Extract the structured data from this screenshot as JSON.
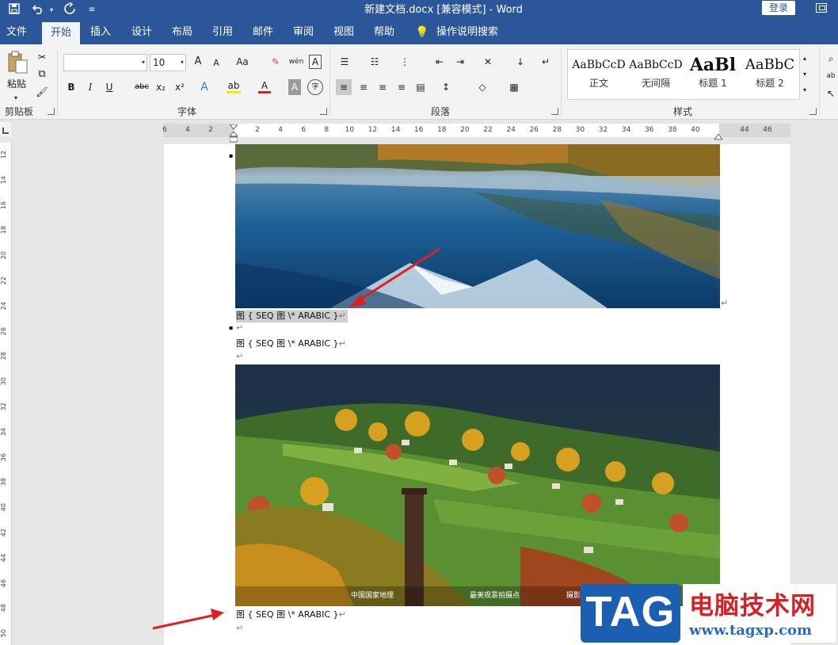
{
  "window": {
    "doc_title": "新建文档.docx [兼容模式]  -  Word",
    "login_label": "登录",
    "quick_access": [
      "save-icon",
      "undo-icon",
      "redo-icon",
      "customize-icon"
    ]
  },
  "tabs": [
    "文件",
    "开始",
    "插入",
    "设计",
    "布局",
    "引用",
    "邮件",
    "审阅",
    "视图",
    "帮助"
  ],
  "active_tab": "开始",
  "tell_me": "操作说明搜索",
  "ribbon": {
    "clipboard": {
      "paste_label": "粘贴",
      "group_label": "剪贴板"
    },
    "font": {
      "font_name": "",
      "font_size": "10",
      "grow_label": "A",
      "shrink_label": "A",
      "change_case_label": "Aa",
      "pinyin_label": "wén",
      "border_char_label": "A",
      "bold": "B",
      "italic": "I",
      "underline": "U",
      "strike": "abc",
      "subscript": "x₂",
      "superscript": "x²",
      "text_effect": "A",
      "highlight": "ab",
      "font_color": "A",
      "char_shading": "A",
      "enclose": "字",
      "group_label": "字体"
    },
    "paragraph": {
      "group_label": "段落"
    },
    "styles": {
      "items": [
        {
          "sample": "AaBbCcD",
          "name": "正文"
        },
        {
          "sample": "AaBbCcD",
          "name": "无间隔"
        },
        {
          "sample": "AaBl",
          "name": "标题 1"
        },
        {
          "sample": "AaBbC",
          "name": "标题 2"
        }
      ],
      "group_label": "样式"
    }
  },
  "ruler": {
    "horizontal_left": [
      "6",
      "4",
      "2"
    ],
    "horizontal": [
      "2",
      "4",
      "6",
      "8",
      "10",
      "12",
      "14",
      "16",
      "18",
      "20",
      "22",
      "24",
      "26",
      "28",
      "30",
      "32",
      "34",
      "36",
      "38",
      "40"
    ],
    "horizontal_right": [
      "44",
      "46"
    ],
    "vertical": [
      "12",
      "14",
      "16",
      "18",
      "20",
      "22",
      "24",
      "26",
      "28",
      "30",
      "32",
      "34",
      "36",
      "38",
      "40",
      "42",
      "44",
      "46",
      "48",
      "50"
    ]
  },
  "document": {
    "caption_1": "图 { SEQ 图 \\* ARABIC }",
    "caption_2": "图 { SEQ 图 \\* ARABIC }",
    "caption_3": "图 { SEQ 图 \\* ARABIC }",
    "paragraph_mark": "↵",
    "photo2_credit_left": "中国国家地理",
    "photo2_credit_mid": "最美观景拍摄点",
    "photo2_credit_right": "摄影"
  },
  "watermark": {
    "logo": "TAG",
    "title": "电脑技术网",
    "url": "www.tagxp.com"
  },
  "colors": {
    "title_bar": "#2b579a",
    "ribbon": "#f3f3f3",
    "arrow": "#e02020"
  }
}
